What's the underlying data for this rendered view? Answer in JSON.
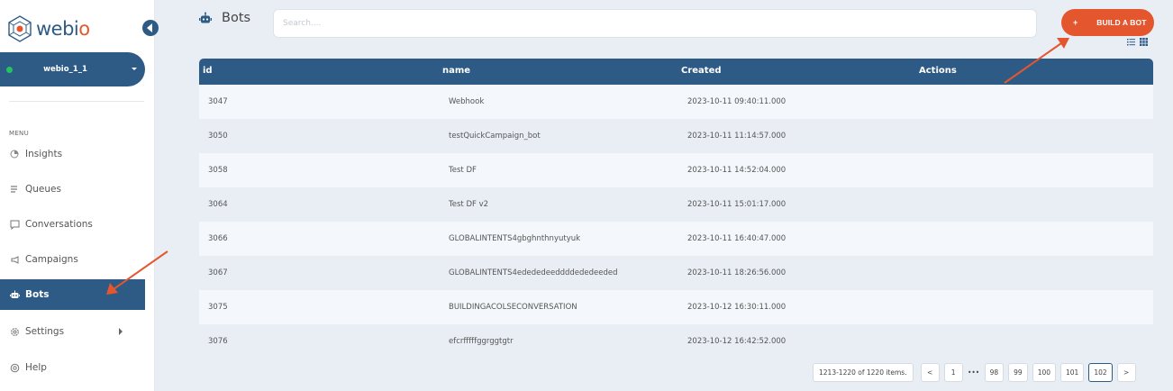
{
  "brand": {
    "name_main": "webi",
    "name_accent": "o"
  },
  "workspace": {
    "name": "webio_1_1"
  },
  "menu": {
    "label": "MENU",
    "items": [
      {
        "label": "Insights",
        "icon": "insights-icon"
      },
      {
        "label": "Queues",
        "icon": "queues-icon"
      },
      {
        "label": "Conversations",
        "icon": "conversations-icon"
      },
      {
        "label": "Campaigns",
        "icon": "campaigns-icon"
      },
      {
        "label": "Bots",
        "icon": "robot-icon",
        "active": true
      },
      {
        "label": "Settings",
        "icon": "gear-icon",
        "has_submenu": true
      },
      {
        "label": "Help",
        "icon": "help-icon"
      }
    ]
  },
  "header": {
    "title": "Bots",
    "search_placeholder": "Search....",
    "build_button": {
      "plus": "+",
      "label": "BUILD A BOT"
    }
  },
  "table": {
    "columns": {
      "id": "id",
      "name": "name",
      "created": "Created",
      "actions": "Actions"
    },
    "rows": [
      {
        "id": "3047",
        "name": "Webhook",
        "created": "2023-10-11 09:40:11.000"
      },
      {
        "id": "3050",
        "name": "testQuickCampaign_bot",
        "created": "2023-10-11 11:14:57.000"
      },
      {
        "id": "3058",
        "name": "Test DF",
        "created": "2023-10-11 14:52:04.000"
      },
      {
        "id": "3064",
        "name": "Test DF v2",
        "created": "2023-10-11 15:01:17.000"
      },
      {
        "id": "3066",
        "name": "GLOBALINTENTS4gbghnthnyutyuk",
        "created": "2023-10-11 16:40:47.000"
      },
      {
        "id": "3067",
        "name": "GLOBALINTENTS4edededeeddddededeeded",
        "created": "2023-10-11 18:26:56.000"
      },
      {
        "id": "3075",
        "name": "BUILDINGACOLSECONVERSATION",
        "created": "2023-10-12 16:30:11.000"
      },
      {
        "id": "3076",
        "name": "efcrfffffggrggtgtr",
        "created": "2023-10-12 16:42:52.000"
      }
    ]
  },
  "pagination": {
    "info": "1213-1220 of 1220 items.",
    "prev": "<",
    "next": ">",
    "ellipsis": "•••",
    "pages": [
      "1",
      "98",
      "99",
      "100",
      "101",
      "102"
    ],
    "current": "102"
  },
  "colors": {
    "primary": "#2e5b86",
    "accent": "#e4572e",
    "status_online": "#22c55e"
  }
}
